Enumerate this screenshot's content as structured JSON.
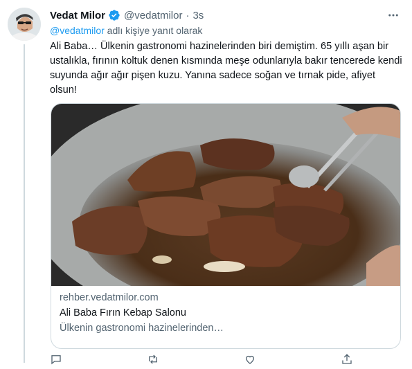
{
  "author": {
    "name": "Vedat Milor",
    "handle": "@vedatmilor",
    "separator": "·",
    "time": "3s"
  },
  "reply": {
    "mention": "@vedatmilor",
    "suffix": " adlı kişiye yanıt olarak"
  },
  "tweet": {
    "text": "Ali Baba… Ülkenin gastronomi hazinelerinden biri demiştim. 65 yıllı aşan bir ustalıkla, fırının koltuk denen kısmında meşe odunlarıyla bakır tencerede kendi suyunda ağır ağır pişen kuzu. Yanına sadece soğan ve tırnak pide, afiyet olsun!"
  },
  "card": {
    "domain": "rehber.vedatmilor.com",
    "title": "Ali Baba Fırın Kebap Salonu",
    "description": "Ülkenin gastronomi hazinelerinden…"
  },
  "icons": {
    "verified": "verified-badge-icon",
    "more": "more-options-icon",
    "reply": "reply-icon",
    "retweet": "retweet-icon",
    "like": "like-icon",
    "share": "share-icon"
  },
  "colors": {
    "accent": "#1d9bf0",
    "secondary_text": "#536471",
    "border": "#cfd9de"
  }
}
